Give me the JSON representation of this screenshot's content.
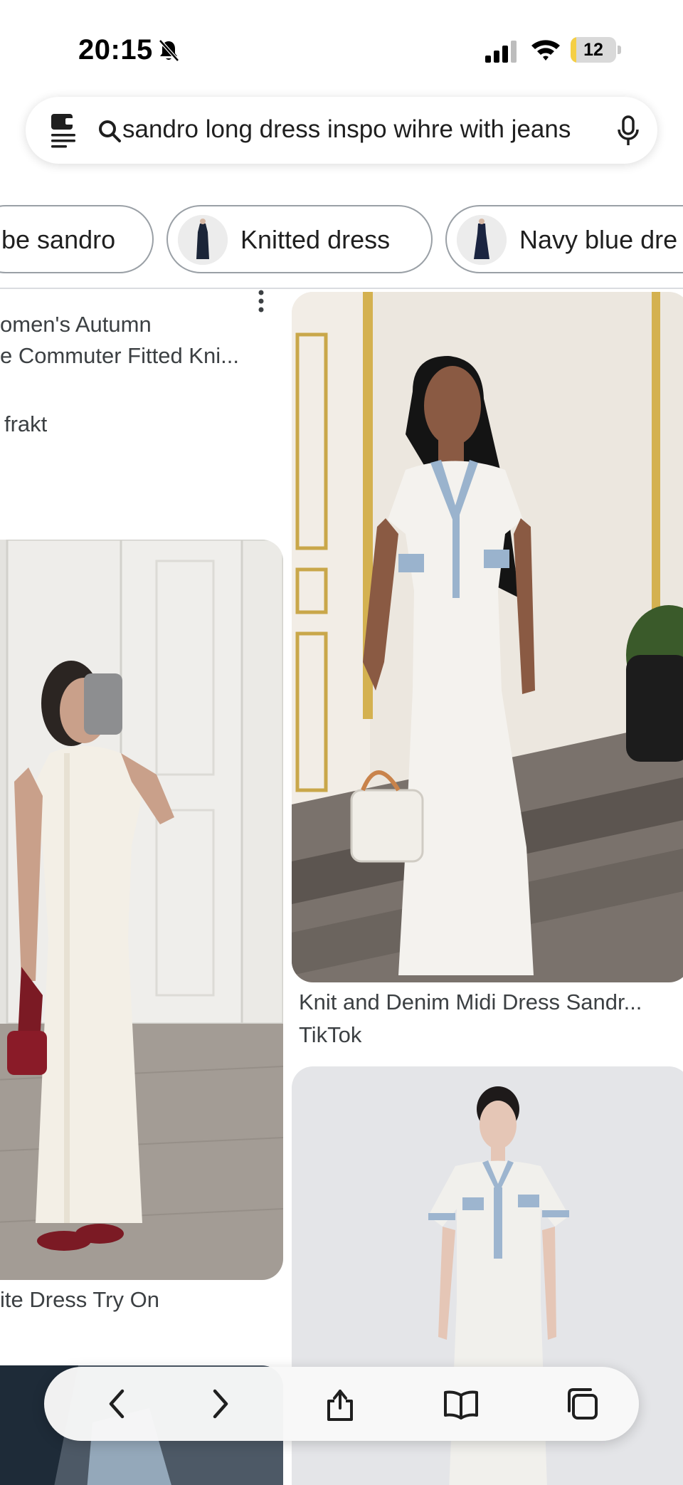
{
  "status": {
    "time": "20:15",
    "battery": "12",
    "battery_level": 0.12
  },
  "search": {
    "query": "sandro long dress inspo wihre with jeans"
  },
  "chips": [
    {
      "label": "be sandro"
    },
    {
      "label": "Knitted dress"
    },
    {
      "label": "Navy blue dre"
    }
  ],
  "results": {
    "left_top": {
      "line1": "omen's Autumn",
      "line2": "e Commuter Fitted Kni...",
      "line3": "frakt"
    },
    "left_mirror": {
      "title": "ite Dress Try On"
    },
    "right_main": {
      "title": "Knit and Denim Midi Dress Sandr...",
      "source": "TikTok"
    }
  },
  "toolbar": {
    "back": "chevron-left-icon",
    "forward": "chevron-right-icon",
    "share": "share-icon",
    "bookmarks": "book-icon",
    "tabs": "tabs-icon"
  },
  "colors": {
    "chip_border": "#9aa0a6",
    "battery_fill": "#f5cf45",
    "text": "#1f1f1f"
  }
}
